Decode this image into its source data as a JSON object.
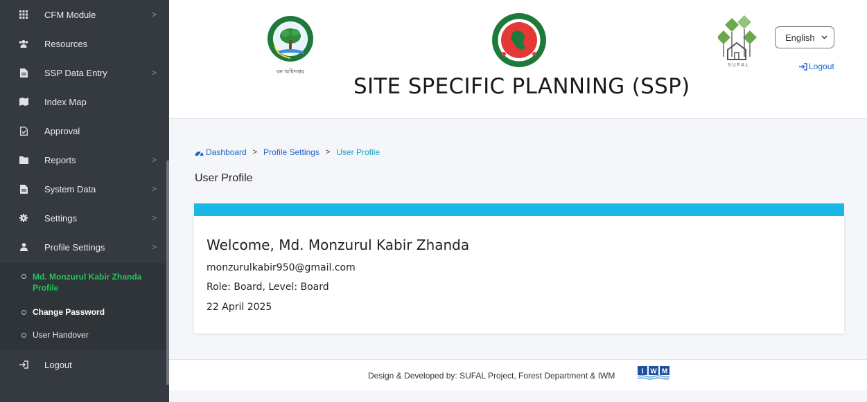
{
  "sidebar": {
    "items": [
      {
        "label": "CFM Module",
        "icon": "grid-icon",
        "chevron": ">"
      },
      {
        "label": "Resources",
        "icon": "users-icon",
        "chevron": ""
      },
      {
        "label": "SSP Data Entry",
        "icon": "file-icon",
        "chevron": ">"
      },
      {
        "label": "Index Map",
        "icon": "map-icon",
        "chevron": ""
      },
      {
        "label": "Approval",
        "icon": "file-check-icon",
        "chevron": ""
      },
      {
        "label": "Reports",
        "icon": "folder-icon",
        "chevron": ">"
      },
      {
        "label": "System Data",
        "icon": "file-icon",
        "chevron": ">"
      },
      {
        "label": "Settings",
        "icon": "gear-icon",
        "chevron": ">"
      },
      {
        "label": "Profile Settings",
        "icon": "user-icon",
        "chevron": ">"
      }
    ],
    "submenu": [
      {
        "label": "Md. Monzurul Kabir Zhanda Profile"
      },
      {
        "label": "Change Password"
      },
      {
        "label": "User Handover"
      }
    ],
    "logout_label": "Logout"
  },
  "header": {
    "title": "SITE SPECIFIC PLANNING (SSP)",
    "logo_left_caption": "বন অধিদপ্তর",
    "logo_right_caption": "SUFAL",
    "language": "English",
    "logout_label": "Logout"
  },
  "breadcrumb": {
    "dashboard": "Dashboard",
    "profile_settings": "Profile Settings",
    "current": "User Profile",
    "separator": ">"
  },
  "page_title": "User Profile",
  "profile": {
    "welcome": "Welcome, Md. Monzurul Kabir Zhanda",
    "email": "monzurulkabir950@gmail.com",
    "role_level": "Role: Board, Level: Board",
    "date": "22 April 2025"
  },
  "footer": {
    "text": "Design & Developed by:  SUFAL Project, Forest Department & IWM",
    "iwm_logo_text": "IWM"
  },
  "colors": {
    "sidebar_bg": "#343a40",
    "active_green": "#22c55e",
    "accent_bar": "#1ab8e6",
    "link_blue": "#1f64c8"
  }
}
